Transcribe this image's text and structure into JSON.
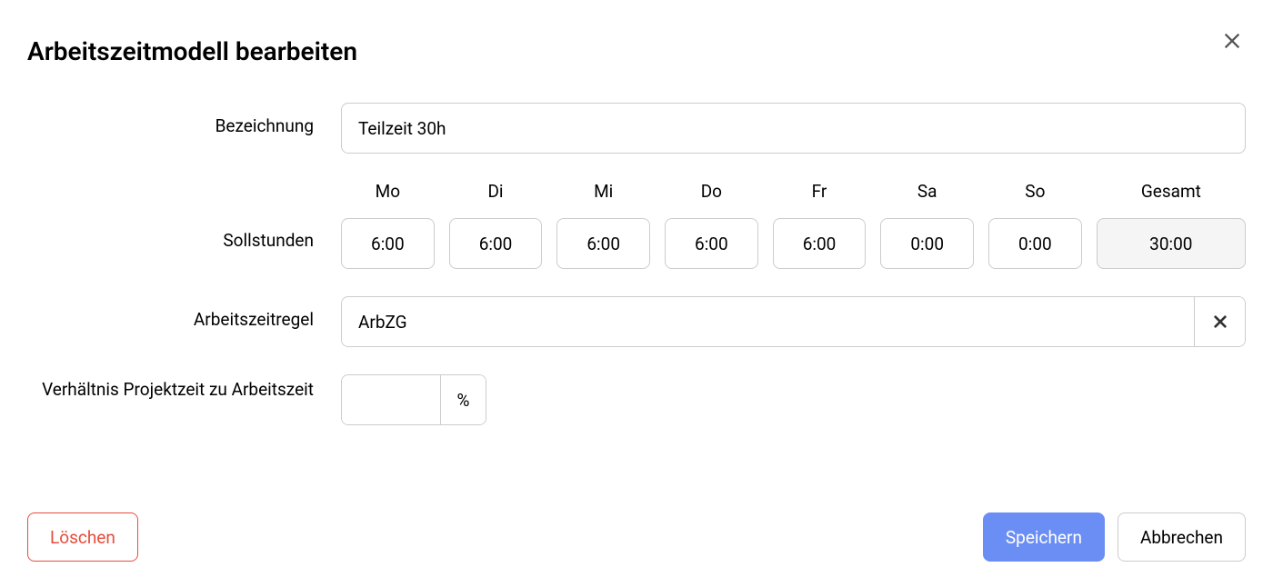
{
  "dialog": {
    "title": "Arbeitszeitmodell bearbeiten",
    "close_label": "Schließen"
  },
  "labels": {
    "name": "Bezeichnung",
    "target_hours": "Sollstunden",
    "worktime_rule": "Arbeitszeitregel",
    "ratio": "Verhältnis Projektzeit zu Arbeitszeit"
  },
  "fields": {
    "name_value": "Teilzeit 30h",
    "worktime_rule_value": "ArbZG",
    "ratio_value": "",
    "percent_suffix": "%"
  },
  "days": {
    "headers": [
      "Mo",
      "Di",
      "Mi",
      "Do",
      "Fr",
      "Sa",
      "So"
    ],
    "values": [
      "6:00",
      "6:00",
      "6:00",
      "6:00",
      "6:00",
      "0:00",
      "0:00"
    ],
    "total_header": "Gesamt",
    "total_value": "30:00"
  },
  "buttons": {
    "delete": "Löschen",
    "save": "Speichern",
    "cancel": "Abbrechen"
  }
}
